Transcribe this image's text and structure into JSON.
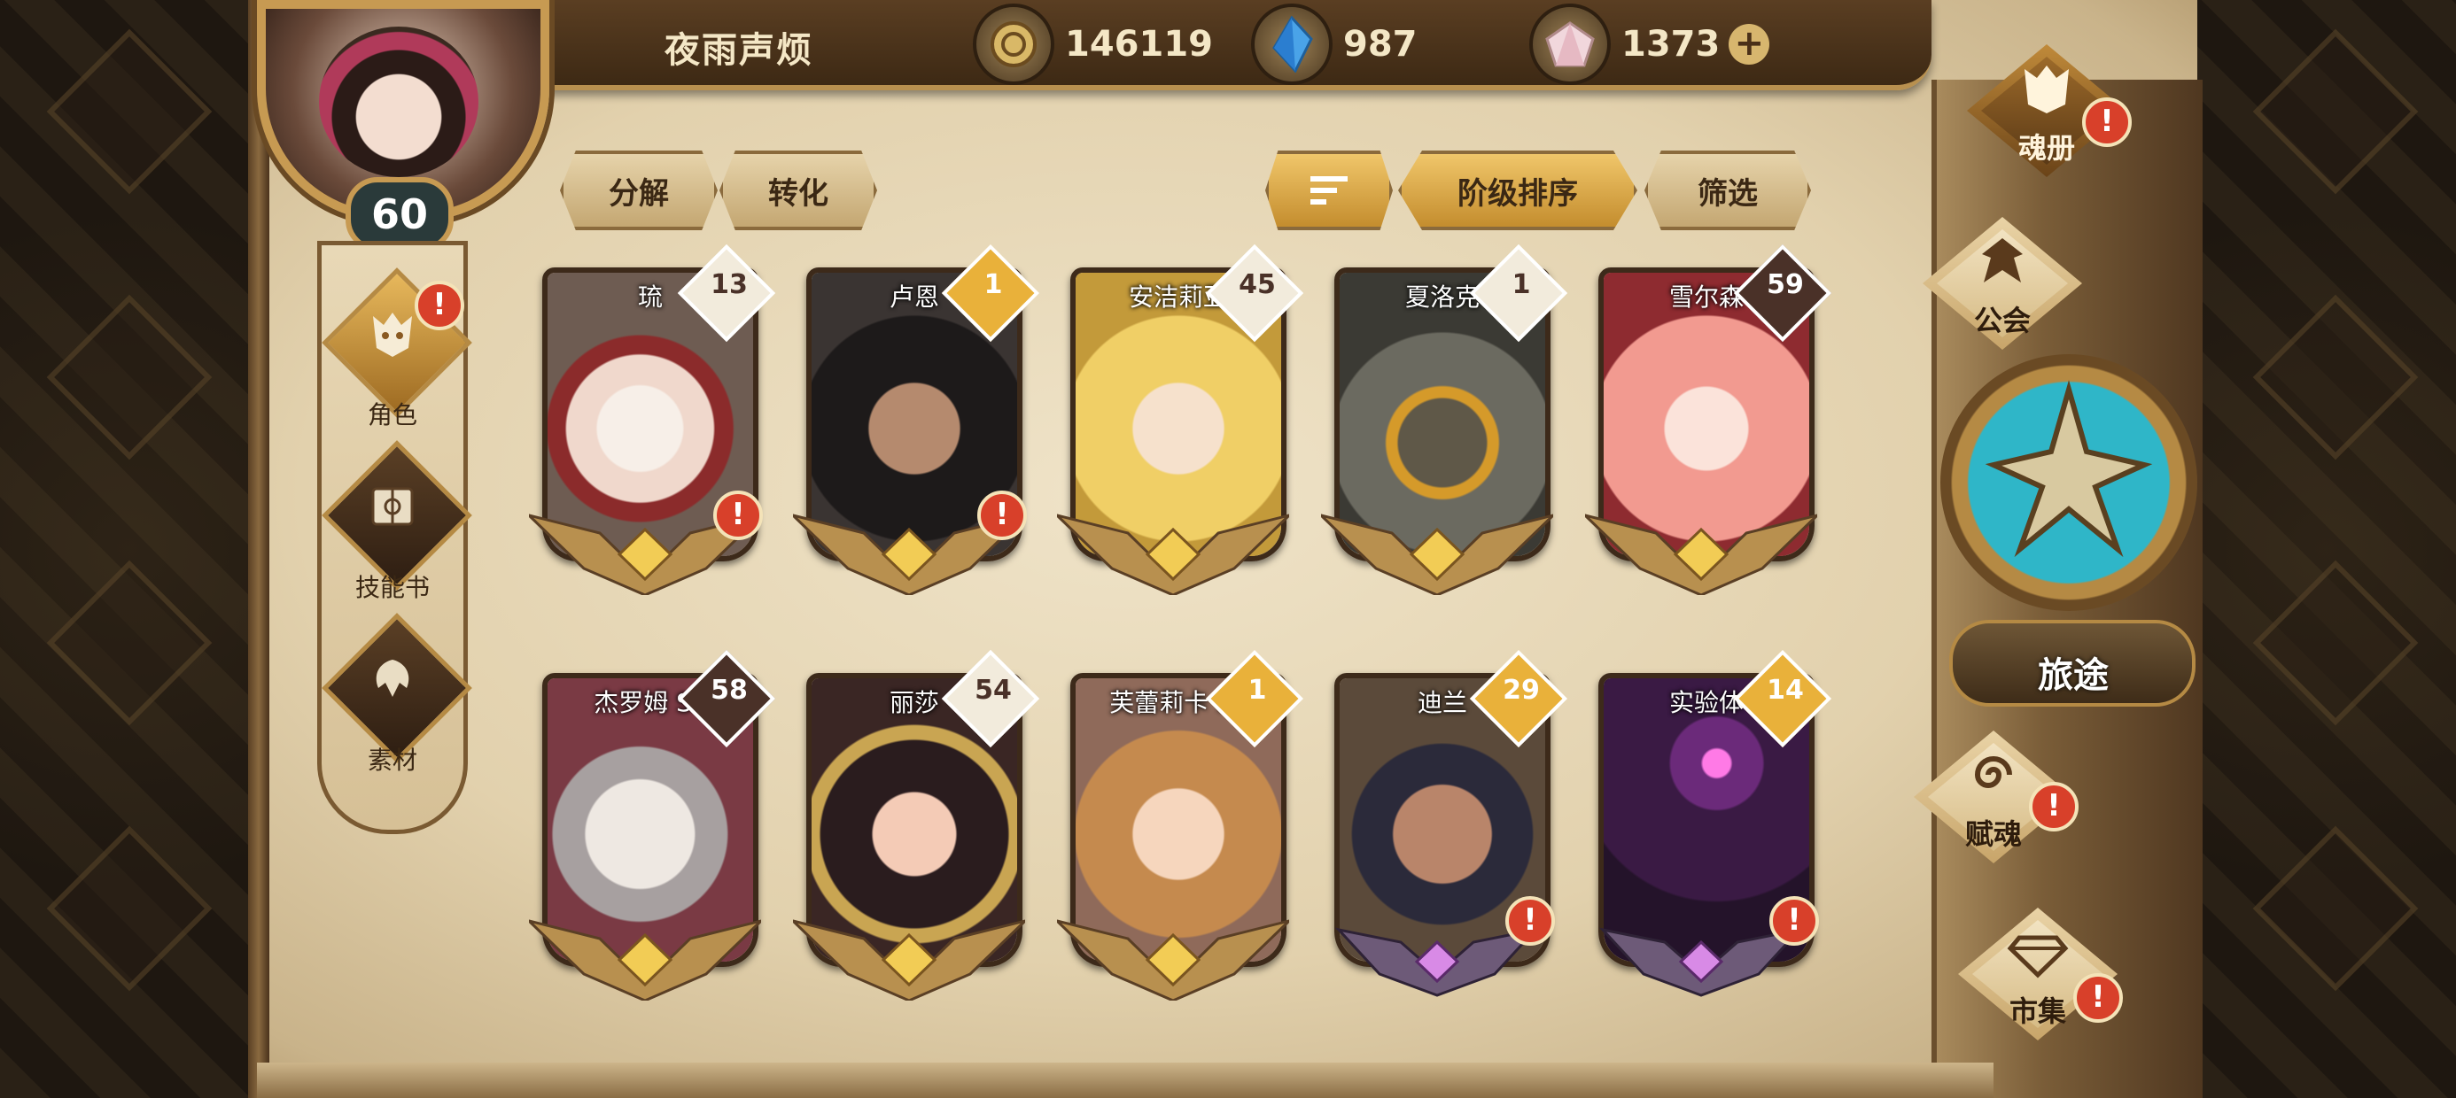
{
  "player": {
    "name": "夜雨声烦",
    "level": "60"
  },
  "currencies": [
    {
      "icon": "gold-coin-icon",
      "value": "146119"
    },
    {
      "icon": "blue-crystal-icon",
      "value": "987"
    },
    {
      "icon": "pink-gem-icon",
      "value": "1373",
      "plus": "+"
    }
  ],
  "left_menu": [
    {
      "label": "角色",
      "icon": "soul-mask-icon",
      "alert": "!"
    },
    {
      "label": "技能书",
      "icon": "skill-book-icon"
    },
    {
      "label": "素材",
      "icon": "material-icon"
    }
  ],
  "toolbar": {
    "decompose": "分解",
    "convert": "转化",
    "sort_icon": "sort-icon",
    "rank_sort": "阶级排序",
    "filter": "筛选"
  },
  "cards": [
    {
      "name": "琉",
      "rank": "13",
      "alert": "!"
    },
    {
      "name": "卢恩",
      "rank": "1",
      "alert": "!"
    },
    {
      "name": "安洁莉亚",
      "rank": "45"
    },
    {
      "name": "夏洛克",
      "rank": "1"
    },
    {
      "name": "雪尔森",
      "rank": "59"
    },
    {
      "name": "杰罗姆 SP",
      "rank": "58"
    },
    {
      "name": "丽莎",
      "rank": "54"
    },
    {
      "name": "芙蕾莉卡 SP",
      "rank": "1"
    },
    {
      "name": "迪兰",
      "rank": "29",
      "alert": "!"
    },
    {
      "name": "实验体",
      "rank": "14",
      "alert": "!"
    }
  ],
  "right_menu": [
    {
      "label": "魂册",
      "icon": "soul-book-icon",
      "alert": "!"
    },
    {
      "label": "公会",
      "icon": "guild-icon"
    },
    {
      "label": "赋魂",
      "icon": "spiral-icon",
      "alert": "!"
    },
    {
      "label": "市集",
      "icon": "market-diamond-icon",
      "alert": "!"
    }
  ],
  "journey": {
    "label": "旅途"
  },
  "colors": {
    "gold_rank": "#e9b13a",
    "white_rank": "#f2ebdc",
    "dark_rank": "#4a3128",
    "accent": "#d8402a",
    "teal": "#2fb6c8"
  }
}
